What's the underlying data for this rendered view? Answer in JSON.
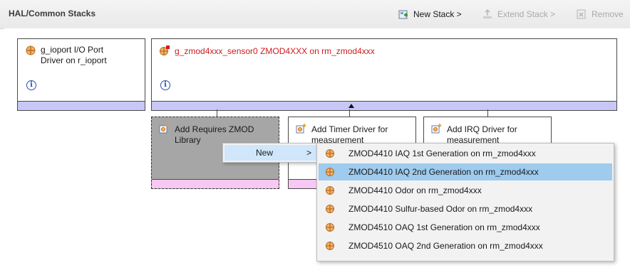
{
  "header": {
    "title": "HAL/Common Stacks",
    "new_stack": "New Stack >",
    "extend_stack": "Extend Stack >",
    "remove": "Remove"
  },
  "modules": {
    "ioport": {
      "line1": "g_ioport I/O Port",
      "line2": "Driver on r_ioport",
      "info": "i"
    },
    "sensor": {
      "title": "g_zmod4xxx_sensor0 ZMOD4XXX on rm_zmod4xxx",
      "info": "i"
    }
  },
  "children": {
    "zmod_lib": {
      "line1": "Add Requires ZMOD",
      "line2": "Library"
    },
    "timer": {
      "line1": "Add Timer Driver for",
      "line2": "measurement"
    },
    "irq": {
      "line1": "Add IRQ Driver for",
      "line2": "measurement"
    }
  },
  "context_menu": {
    "new_label": "New",
    "submenu_arrow": ">",
    "items": [
      "ZMOD4410 IAQ 1st Generation on rm_zmod4xxx",
      "ZMOD4410 IAQ 2nd Generation on rm_zmod4xxx",
      "ZMOD4410 Odor on rm_zmod4xxx",
      "ZMOD4410 Sulfur-based Odor on rm_zmod4xxx",
      "ZMOD4510 OAQ 1st Generation on rm_zmod4xxx",
      "ZMOD4510 OAQ 2nd Generation on rm_zmod4xxx"
    ],
    "selected_index": 1
  },
  "colors": {
    "module_strip": "#c9c7f5",
    "child_strip": "#f6c8f3",
    "selected_item": "#9ecbee",
    "title_red": "#d01c1c"
  }
}
